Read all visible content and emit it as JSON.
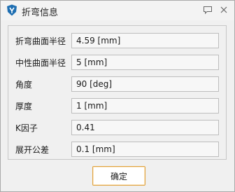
{
  "window": {
    "title": "折弯信息"
  },
  "fields": [
    {
      "label": "折弯曲面半径",
      "value": "4.59  [mm]"
    },
    {
      "label": "中性曲面半径",
      "value": "5  [mm]"
    },
    {
      "label": "角度",
      "value": "90  [deg]"
    },
    {
      "label": "厚度",
      "value": "1  [mm]"
    },
    {
      "label": "K因子",
      "value": "0.41"
    },
    {
      "label": "展开公差",
      "value": "0.1  [mm]"
    }
  ],
  "buttons": {
    "ok_label": "确定"
  },
  "icons": {
    "app": "app-logo-icon",
    "help": "comment-icon",
    "close": "close-icon"
  },
  "colors": {
    "accent": "#e0a340",
    "logo": "#1f6fb2"
  }
}
